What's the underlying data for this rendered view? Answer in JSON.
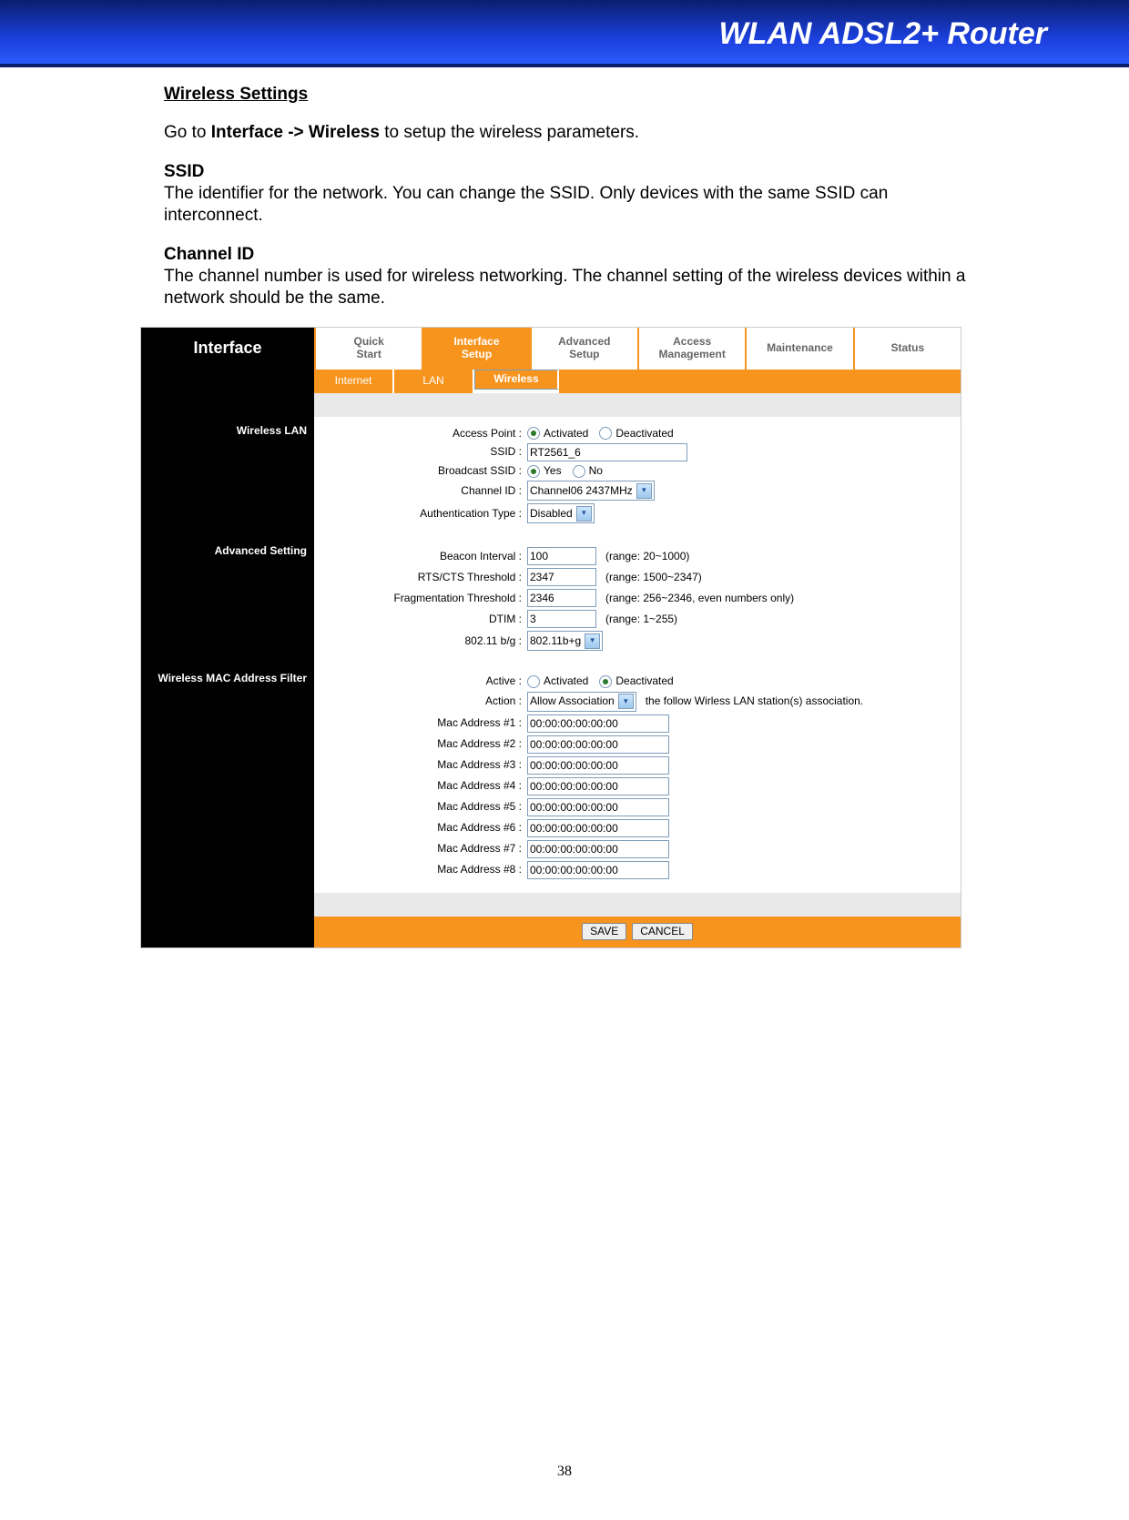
{
  "banner": {
    "title": "WLAN ADSL2+ Router"
  },
  "doc": {
    "heading": "Wireless Settings  ",
    "intro_pre": "Go to ",
    "intro_bold": "Interface -> Wireless",
    "intro_post": " to setup the wireless parameters.",
    "ssid_h": "SSID",
    "ssid_p": "The identifier for the network. You can change the SSID. Only devices with the same SSID can interconnect.",
    "ch_h": "Channel ID",
    "ch_p": "The channel number is used for wireless networking. The channel setting of the wireless devices within a network should be the same."
  },
  "shot": {
    "side_title": "Interface",
    "tabs": [
      "Quick\nStart",
      "Interface\nSetup",
      "Advanced\nSetup",
      "Access\nManagement",
      "Maintenance",
      "Status"
    ],
    "tabs_active": 1,
    "subtabs": [
      "Internet",
      "LAN",
      "Wireless"
    ],
    "subtabs_active": 2,
    "sections": {
      "wlan": {
        "title": "Wireless LAN",
        "ap_l": "Access Point :",
        "ap_a": "Activated",
        "ap_d": "Deactivated",
        "ssid_l": "SSID :",
        "ssid_v": "RT2561_6",
        "bssid_l": "Broadcast SSID :",
        "bssid_y": "Yes",
        "bssid_n": "No",
        "chid_l": "Channel ID :",
        "chid_v": "Channel06 2437MHz",
        "auth_l": "Authentication Type :",
        "auth_v": "Disabled"
      },
      "adv": {
        "title": "Advanced Setting",
        "bi_l": "Beacon Interval :",
        "bi_v": "100",
        "bi_h": "(range: 20~1000)",
        "rts_l": "RTS/CTS Threshold :",
        "rts_v": "2347",
        "rts_h": "(range: 1500~2347)",
        "frag_l": "Fragmentation Threshold :",
        "frag_v": "2346",
        "frag_h": "(range: 256~2346, even numbers only)",
        "dtim_l": "DTIM :",
        "dtim_v": "3",
        "dtim_h": "(range: 1~255)",
        "mode_l": "802.11 b/g :",
        "mode_v": "802.11b+g"
      },
      "mac": {
        "title": "Wireless MAC Address Filter",
        "active_l": "Active :",
        "act_a": "Activated",
        "act_d": "Deactivated",
        "action_l": "Action :",
        "action_v": "Allow Association",
        "action_post": "the follow Wirless LAN station(s) association.",
        "labels": [
          "Mac Address #1 :",
          "Mac Address #2 :",
          "Mac Address #3 :",
          "Mac Address #4 :",
          "Mac Address #5 :",
          "Mac Address #6 :",
          "Mac Address #7 :",
          "Mac Address #8 :"
        ],
        "value": "00:00:00:00:00:00"
      }
    },
    "buttons": {
      "save": "SAVE",
      "cancel": "CANCEL"
    }
  },
  "page_number": "38"
}
